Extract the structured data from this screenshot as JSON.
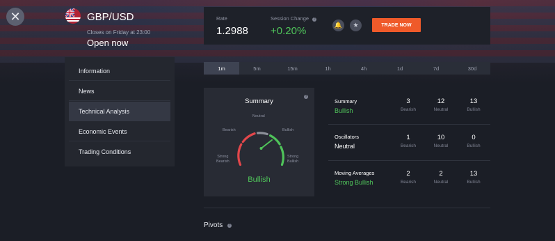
{
  "asset": {
    "name": "GBP/USD",
    "closes_text": "Closes on Friday at 23:00",
    "status": "Open now"
  },
  "ticker": {
    "rate_label": "Rate",
    "rate_value": "1.2988",
    "change_label": "Session Change",
    "change_value": "+0.20%",
    "trade_button": "TRADE NOW"
  },
  "sidebar": {
    "items": [
      {
        "label": "Information"
      },
      {
        "label": "News"
      },
      {
        "label": "Technical Analysis",
        "active": true
      },
      {
        "label": "Economic Events"
      },
      {
        "label": "Trading Conditions"
      }
    ]
  },
  "timeframes": [
    "1m",
    "5m",
    "15m",
    "1h",
    "4h",
    "1d",
    "7d",
    "30d"
  ],
  "active_timeframe": "1m",
  "gauge": {
    "title": "Summary",
    "labels": {
      "strong_bearish": "Strong\nBearish",
      "bearish": "Bearish",
      "neutral": "Neutral",
      "bullish": "Bullish",
      "strong_bullish": "Strong\nBullish"
    },
    "result": "Bullish"
  },
  "rows": [
    {
      "label": "Summary",
      "value": "Bullish",
      "counts": [
        "3",
        "12",
        "13"
      ]
    },
    {
      "label": "Oscillators",
      "value": "Neutral",
      "counts": [
        "1",
        "10",
        "0"
      ]
    },
    {
      "label": "Moving Averages",
      "value": "Strong Bullish",
      "counts": [
        "2",
        "2",
        "13"
      ]
    }
  ],
  "count_labels": [
    "Bearish",
    "Neutral",
    "Bullish"
  ],
  "pivots_title": "Pivots",
  "colors": {
    "accent_orange": "#ef5a2a",
    "positive_green": "#4fc35a",
    "bearish_red": "#e2474b"
  }
}
